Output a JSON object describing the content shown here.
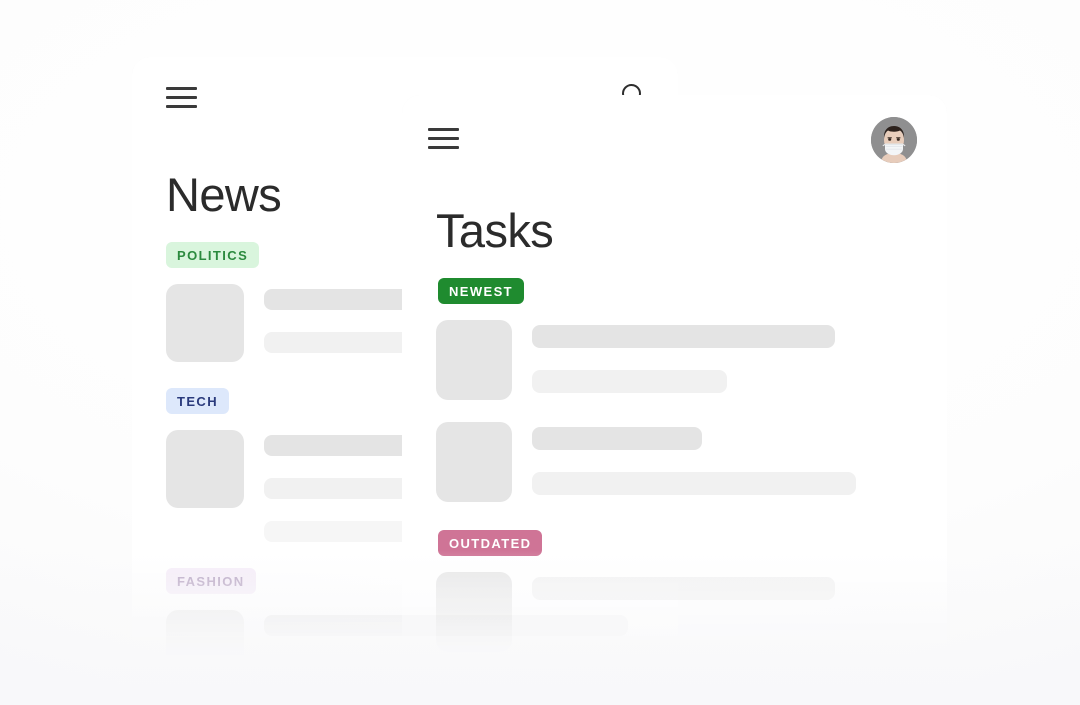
{
  "background_color": "#fbfbfb",
  "cards": [
    {
      "id": "news",
      "title": "News",
      "menu_icon": "hamburger-menu-icon",
      "action_icon": "search-icon",
      "sections": [
        {
          "badge": {
            "label": "POLITICS",
            "style": "soft-green",
            "bg": "#d9f5dd",
            "fg": "#2b8a3e"
          },
          "items": [
            {
              "lines": 2
            }
          ]
        },
        {
          "badge": {
            "label": "TECH",
            "style": "soft-blue",
            "bg": "#dde8fb",
            "fg": "#2a3a7c"
          },
          "items": [
            {
              "lines": 3
            }
          ]
        },
        {
          "badge": {
            "label": "FASHION",
            "style": "soft-purple",
            "bg": "#f3e9f7",
            "fg": "#a892b6"
          },
          "items": [
            {
              "lines": 2
            }
          ]
        }
      ]
    },
    {
      "id": "tasks",
      "title": "Tasks",
      "menu_icon": "hamburger-menu-icon",
      "action_icon": "avatar-icon",
      "avatar_alt": "person-wearing-face-mask",
      "sections": [
        {
          "badge": {
            "label": "NEWEST",
            "style": "solid-green",
            "bg": "#1f8b2f",
            "fg": "#ffffff"
          },
          "items": [
            {
              "lines": 2
            },
            {
              "lines": 2
            }
          ]
        },
        {
          "badge": {
            "label": "OUTDATED",
            "style": "solid-rose",
            "bg": "#cf7496",
            "fg": "#ffffff"
          },
          "items": [
            {
              "lines": 1
            }
          ]
        }
      ]
    }
  ],
  "skeleton": {
    "placeholder_dark": "#e4e4e4",
    "placeholder_light": "#f1f1f1",
    "thumb_color": "#e5e5e5"
  }
}
